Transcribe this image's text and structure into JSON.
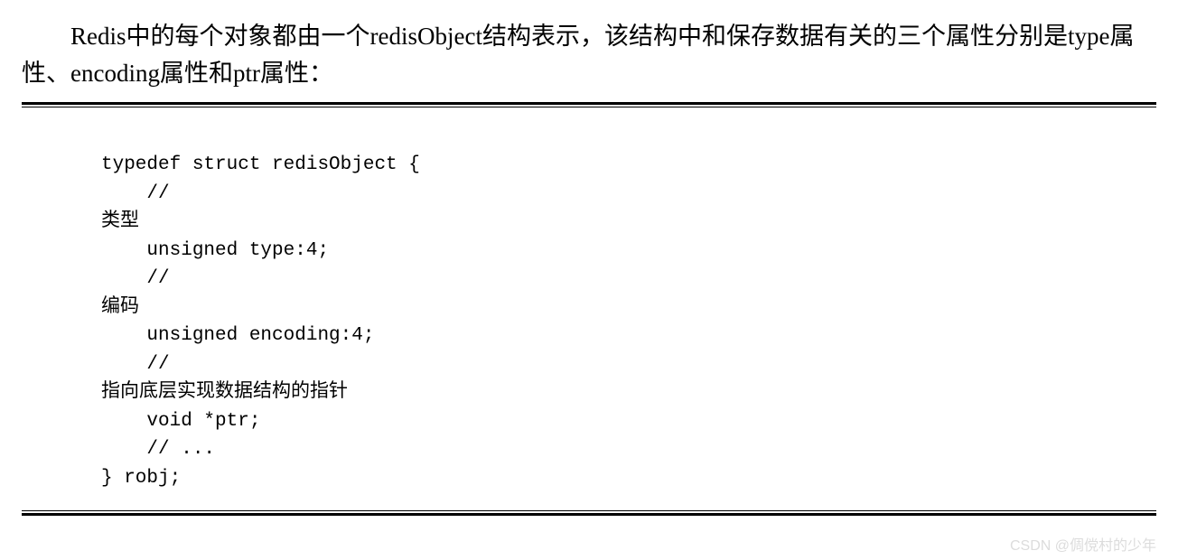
{
  "intro": "Redis中的每个对象都由一个redisObject结构表示，该结构中和保存数据有关的三个属性分别是type属性、encoding属性和ptr属性：",
  "code": "typedef struct redisObject {\n    // \n类型\n    unsigned type:4;\n    // \n编码\n    unsigned encoding:4;\n    // \n指向底层实现数据结构的指针\n    void *ptr;\n    // ...\n} robj;",
  "watermark": "CSDN @倜傥村的少年"
}
